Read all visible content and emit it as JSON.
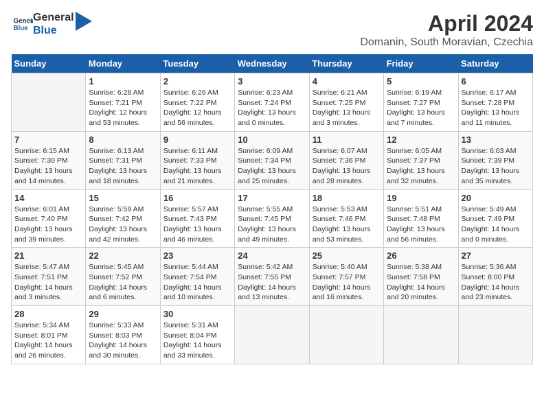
{
  "header": {
    "logo_general": "General",
    "logo_blue": "Blue",
    "title": "April 2024",
    "subtitle": "Domanin, South Moravian, Czechia"
  },
  "weekdays": [
    "Sunday",
    "Monday",
    "Tuesday",
    "Wednesday",
    "Thursday",
    "Friday",
    "Saturday"
  ],
  "weeks": [
    [
      {
        "day": "",
        "content": ""
      },
      {
        "day": "1",
        "content": "Sunrise: 6:28 AM\nSunset: 7:21 PM\nDaylight: 12 hours\nand 53 minutes."
      },
      {
        "day": "2",
        "content": "Sunrise: 6:26 AM\nSunset: 7:22 PM\nDaylight: 12 hours\nand 56 minutes."
      },
      {
        "day": "3",
        "content": "Sunrise: 6:23 AM\nSunset: 7:24 PM\nDaylight: 13 hours\nand 0 minutes."
      },
      {
        "day": "4",
        "content": "Sunrise: 6:21 AM\nSunset: 7:25 PM\nDaylight: 13 hours\nand 3 minutes."
      },
      {
        "day": "5",
        "content": "Sunrise: 6:19 AM\nSunset: 7:27 PM\nDaylight: 13 hours\nand 7 minutes."
      },
      {
        "day": "6",
        "content": "Sunrise: 6:17 AM\nSunset: 7:28 PM\nDaylight: 13 hours\nand 11 minutes."
      }
    ],
    [
      {
        "day": "7",
        "content": "Sunrise: 6:15 AM\nSunset: 7:30 PM\nDaylight: 13 hours\nand 14 minutes."
      },
      {
        "day": "8",
        "content": "Sunrise: 6:13 AM\nSunset: 7:31 PM\nDaylight: 13 hours\nand 18 minutes."
      },
      {
        "day": "9",
        "content": "Sunrise: 6:11 AM\nSunset: 7:33 PM\nDaylight: 13 hours\nand 21 minutes."
      },
      {
        "day": "10",
        "content": "Sunrise: 6:09 AM\nSunset: 7:34 PM\nDaylight: 13 hours\nand 25 minutes."
      },
      {
        "day": "11",
        "content": "Sunrise: 6:07 AM\nSunset: 7:36 PM\nDaylight: 13 hours\nand 28 minutes."
      },
      {
        "day": "12",
        "content": "Sunrise: 6:05 AM\nSunset: 7:37 PM\nDaylight: 13 hours\nand 32 minutes."
      },
      {
        "day": "13",
        "content": "Sunrise: 6:03 AM\nSunset: 7:39 PM\nDaylight: 13 hours\nand 35 minutes."
      }
    ],
    [
      {
        "day": "14",
        "content": "Sunrise: 6:01 AM\nSunset: 7:40 PM\nDaylight: 13 hours\nand 39 minutes."
      },
      {
        "day": "15",
        "content": "Sunrise: 5:59 AM\nSunset: 7:42 PM\nDaylight: 13 hours\nand 42 minutes."
      },
      {
        "day": "16",
        "content": "Sunrise: 5:57 AM\nSunset: 7:43 PM\nDaylight: 13 hours\nand 46 minutes."
      },
      {
        "day": "17",
        "content": "Sunrise: 5:55 AM\nSunset: 7:45 PM\nDaylight: 13 hours\nand 49 minutes."
      },
      {
        "day": "18",
        "content": "Sunrise: 5:53 AM\nSunset: 7:46 PM\nDaylight: 13 hours\nand 53 minutes."
      },
      {
        "day": "19",
        "content": "Sunrise: 5:51 AM\nSunset: 7:48 PM\nDaylight: 13 hours\nand 56 minutes."
      },
      {
        "day": "20",
        "content": "Sunrise: 5:49 AM\nSunset: 7:49 PM\nDaylight: 14 hours\nand 0 minutes."
      }
    ],
    [
      {
        "day": "21",
        "content": "Sunrise: 5:47 AM\nSunset: 7:51 PM\nDaylight: 14 hours\nand 3 minutes."
      },
      {
        "day": "22",
        "content": "Sunrise: 5:45 AM\nSunset: 7:52 PM\nDaylight: 14 hours\nand 6 minutes."
      },
      {
        "day": "23",
        "content": "Sunrise: 5:44 AM\nSunset: 7:54 PM\nDaylight: 14 hours\nand 10 minutes."
      },
      {
        "day": "24",
        "content": "Sunrise: 5:42 AM\nSunset: 7:55 PM\nDaylight: 14 hours\nand 13 minutes."
      },
      {
        "day": "25",
        "content": "Sunrise: 5:40 AM\nSunset: 7:57 PM\nDaylight: 14 hours\nand 16 minutes."
      },
      {
        "day": "26",
        "content": "Sunrise: 5:38 AM\nSunset: 7:58 PM\nDaylight: 14 hours\nand 20 minutes."
      },
      {
        "day": "27",
        "content": "Sunrise: 5:36 AM\nSunset: 8:00 PM\nDaylight: 14 hours\nand 23 minutes."
      }
    ],
    [
      {
        "day": "28",
        "content": "Sunrise: 5:34 AM\nSunset: 8:01 PM\nDaylight: 14 hours\nand 26 minutes."
      },
      {
        "day": "29",
        "content": "Sunrise: 5:33 AM\nSunset: 8:03 PM\nDaylight: 14 hours\nand 30 minutes."
      },
      {
        "day": "30",
        "content": "Sunrise: 5:31 AM\nSunset: 8:04 PM\nDaylight: 14 hours\nand 33 minutes."
      },
      {
        "day": "",
        "content": ""
      },
      {
        "day": "",
        "content": ""
      },
      {
        "day": "",
        "content": ""
      },
      {
        "day": "",
        "content": ""
      }
    ]
  ]
}
